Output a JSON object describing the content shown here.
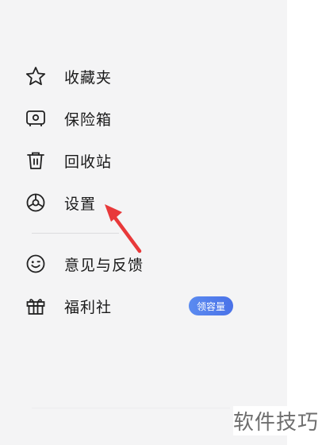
{
  "menu": {
    "items": [
      {
        "id": "favorites",
        "label": "收藏夹",
        "icon": "star-icon"
      },
      {
        "id": "vault",
        "label": "保险箱",
        "icon": "safe-icon"
      },
      {
        "id": "recycle",
        "label": "回收站",
        "icon": "trash-icon"
      },
      {
        "id": "settings",
        "label": "设置",
        "icon": "settings-icon"
      },
      {
        "id": "feedback",
        "label": "意见与反馈",
        "icon": "smile-icon"
      },
      {
        "id": "welfare",
        "label": "福利社",
        "icon": "gift-icon"
      }
    ],
    "welfare_badge": "领容量"
  },
  "watermark": "软件技巧",
  "colors": {
    "panel_bg": "#f4f4f5",
    "badge": "#4a72e8",
    "arrow": "#e8393a"
  }
}
